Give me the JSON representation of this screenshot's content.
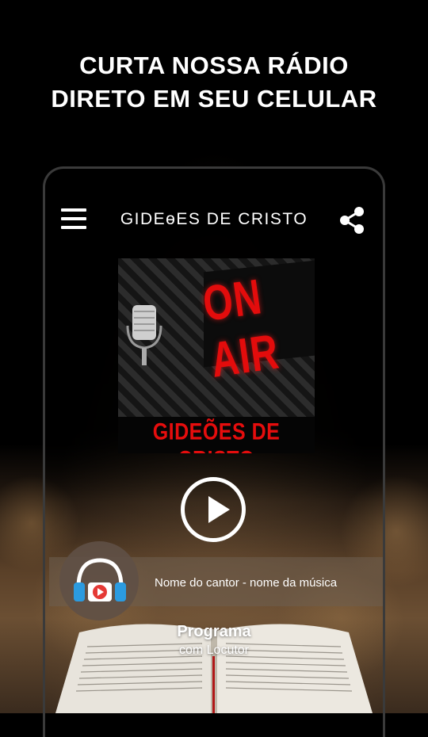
{
  "headline": {
    "line1": "CURTA NOSSA RÁDIO",
    "line2": "DIRETO EM SEU CELULAR"
  },
  "app": {
    "title": "GIDEɵES DE CRISTO",
    "menu_icon": "hamburger-menu-icon",
    "share_icon": "share-icon"
  },
  "artwork": {
    "sign_text": "ON AIR",
    "station_name": "GIDEÕES DE CRISTO"
  },
  "player": {
    "play_icon": "play-icon",
    "now_playing": "Nome do cantor - nome da música",
    "headphone_icon": "headphones-icon"
  },
  "program": {
    "title": "Programa",
    "subtitle": "com Locutor"
  },
  "colors": {
    "accent_red": "#e30c0c",
    "background": "#000000",
    "headphone_blue": "#2b9be0"
  }
}
